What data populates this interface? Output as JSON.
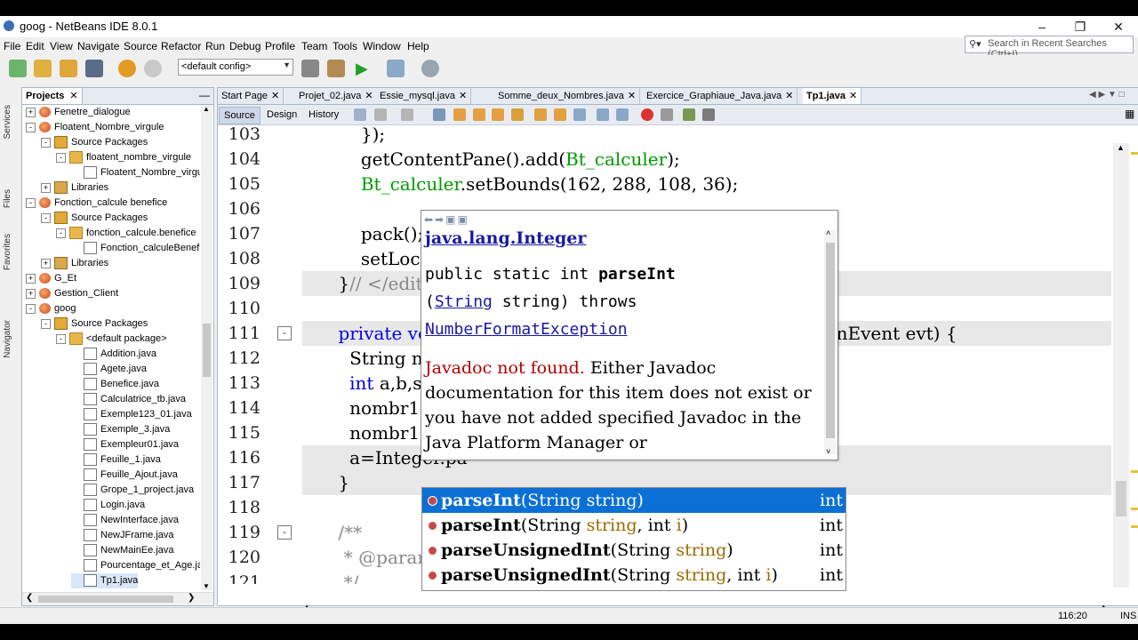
{
  "window": {
    "title": "goog - NetBeans IDE 8.0.1"
  },
  "menu": [
    "File",
    "Edit",
    "View",
    "Navigate",
    "Source",
    "Refactor",
    "Run",
    "Debug",
    "Profile",
    "Team",
    "Tools",
    "Window",
    "Help"
  ],
  "search": {
    "placeholder": "Search in Recent Searches (Ctrl+I)"
  },
  "toolbar": {
    "config_value": "<default config>"
  },
  "side_labels": [
    "Services",
    "Files",
    "Favorites",
    "Navigator"
  ],
  "projects": {
    "tab_label": "Projects",
    "tree": [
      {
        "label": "Fenetre_dialogue",
        "level": 0,
        "icon": "project",
        "exp": "+"
      },
      {
        "label": "Floatent_Nombre_virgule",
        "level": 0,
        "icon": "project",
        "exp": "-"
      },
      {
        "label": "Source Packages",
        "level": 1,
        "icon": "srcpkg",
        "exp": "-"
      },
      {
        "label": "floatent_nombre_virgule",
        "level": 2,
        "icon": "package",
        "exp": "-"
      },
      {
        "label": "Floatent_Nombre_virgule.java",
        "level": 3,
        "icon": "java",
        "exp": ""
      },
      {
        "label": "Libraries",
        "level": 1,
        "icon": "library",
        "exp": "+"
      },
      {
        "label": "Fonction_calcule benefice",
        "level": 0,
        "icon": "project",
        "exp": "-"
      },
      {
        "label": "Source Packages",
        "level": 1,
        "icon": "srcpkg",
        "exp": "-"
      },
      {
        "label": "fonction_calcule.benefice",
        "level": 2,
        "icon": "package",
        "exp": "-"
      },
      {
        "label": "Fonction_calculeBenefice.java",
        "level": 3,
        "icon": "java",
        "exp": ""
      },
      {
        "label": "Libraries",
        "level": 1,
        "icon": "library",
        "exp": "+"
      },
      {
        "label": "G_Et",
        "level": 0,
        "icon": "project",
        "exp": "+"
      },
      {
        "label": "Gestion_Client",
        "level": 0,
        "icon": "project",
        "exp": "+"
      },
      {
        "label": "goog",
        "level": 0,
        "icon": "project",
        "exp": "-"
      },
      {
        "label": "Source Packages",
        "level": 1,
        "icon": "srcpkg",
        "exp": "-"
      },
      {
        "label": "<default package>",
        "level": 2,
        "icon": "package",
        "exp": "-"
      },
      {
        "label": "Addition.java",
        "level": 3,
        "icon": "java",
        "exp": ""
      },
      {
        "label": "Agete.java",
        "level": 3,
        "icon": "java",
        "exp": ""
      },
      {
        "label": "Benefice.java",
        "level": 3,
        "icon": "java",
        "exp": ""
      },
      {
        "label": "Calculatrice_tb.java",
        "level": 3,
        "icon": "java",
        "exp": ""
      },
      {
        "label": "Exemple123_01.java",
        "level": 3,
        "icon": "java",
        "exp": ""
      },
      {
        "label": "Exemple_3.java",
        "level": 3,
        "icon": "java",
        "exp": ""
      },
      {
        "label": "Exempleur01.java",
        "level": 3,
        "icon": "java",
        "exp": ""
      },
      {
        "label": "Feuille_1.java",
        "level": 3,
        "icon": "java",
        "exp": ""
      },
      {
        "label": "Feuille_Ajout.java",
        "level": 3,
        "icon": "java",
        "exp": ""
      },
      {
        "label": "Grope_1_project.java",
        "level": 3,
        "icon": "java",
        "exp": ""
      },
      {
        "label": "Login.java",
        "level": 3,
        "icon": "java",
        "exp": ""
      },
      {
        "label": "NewInterface.java",
        "level": 3,
        "icon": "java",
        "exp": ""
      },
      {
        "label": "NewJFrame.java",
        "level": 3,
        "icon": "java",
        "exp": ""
      },
      {
        "label": "NewMainEe.java",
        "level": 3,
        "icon": "java",
        "exp": ""
      },
      {
        "label": "Pourcentage_et_Age.java",
        "level": 3,
        "icon": "java",
        "exp": ""
      },
      {
        "label": "Tp1.java",
        "level": 3,
        "icon": "java",
        "exp": "",
        "selected": true
      }
    ]
  },
  "editor": {
    "tabs": [
      {
        "label": "Start Page"
      },
      {
        "label": "Projet_02.java"
      },
      {
        "label": "Essie_mysql.java"
      },
      {
        "label": "Somme_deux_Nombres.java"
      },
      {
        "label": "Exercice_Graphiaue_Java.java"
      },
      {
        "label": "Tp1.java",
        "active": true
      }
    ],
    "subtabs": [
      "Source",
      "Design",
      "History"
    ],
    "lines": [
      {
        "n": "103",
        "segs": [
          {
            "t": "        });"
          }
        ]
      },
      {
        "n": "104",
        "segs": [
          {
            "t": "        getContentPane().add("
          },
          {
            "t": "Bt_calculer",
            "c": "fld"
          },
          {
            "t": ");"
          }
        ]
      },
      {
        "n": "105",
        "segs": [
          {
            "t": "        "
          },
          {
            "t": "Bt_calculer",
            "c": "fld"
          },
          {
            "t": ".setBounds(162, 288, 108, 36);"
          }
        ]
      },
      {
        "n": "106",
        "segs": [
          {
            "t": ""
          }
        ]
      },
      {
        "n": "107",
        "segs": [
          {
            "t": "        pack();"
          }
        ]
      },
      {
        "n": "108",
        "segs": [
          {
            "t": "        setLocat"
          }
        ]
      },
      {
        "n": "109",
        "segs": [
          {
            "t": "    }"
          },
          {
            "t": "// </editor",
            "c": "cmt"
          }
        ],
        "hl": true
      },
      {
        "n": "110",
        "segs": [
          {
            "t": ""
          }
        ]
      },
      {
        "n": "111",
        "segs": [
          {
            "t": "    "
          },
          {
            "t": "private",
            "c": "kw"
          },
          {
            "t": " "
          },
          {
            "t": "voi",
            "c": "kw"
          },
          {
            "t": "                              "
          },
          {
            "t": "                         "
          },
          {
            "t": "vent.ActionEvent evt) {"
          }
        ],
        "fold": "-",
        "hl": true
      },
      {
        "n": "112",
        "segs": [
          {
            "t": "      String n"
          }
        ]
      },
      {
        "n": "113",
        "segs": [
          {
            "t": "      "
          },
          {
            "t": "int",
            "c": "kw"
          },
          {
            "t": " a,b,s"
          }
        ]
      },
      {
        "n": "114",
        "segs": [
          {
            "t": "      nombr1="
          }
        ]
      },
      {
        "n": "115",
        "segs": [
          {
            "t": "      nombr1="
          }
        ]
      },
      {
        "n": "116",
        "segs": [
          {
            "t": "      a=Integer.pa"
          }
        ],
        "hl": true
      },
      {
        "n": "117",
        "segs": [
          {
            "t": "    }"
          }
        ],
        "hl": true
      },
      {
        "n": "118",
        "segs": [
          {
            "t": ""
          }
        ]
      },
      {
        "n": "119",
        "segs": [
          {
            "t": "    /**",
            "c": "cmt"
          }
        ],
        "fold": "-"
      },
      {
        "n": "120",
        "segs": [
          {
            "t": "     * @param",
            "c": "cmt"
          }
        ]
      },
      {
        "n": "121",
        "segs": [
          {
            "t": "     */",
            "c": "cmt"
          }
        ]
      }
    ]
  },
  "javadoc": {
    "title": "java.lang.Integer",
    "sig1": "public static int ",
    "method": "parseInt",
    "sig2_open": "(",
    "sig2_type": "String",
    "sig2_rest": " string) throws",
    "exception": "NumberFormatException",
    "msg_red": "Javadoc not found.",
    "msg_rest": " Either Javadoc documentation for this item does not exist or you have not added specified Javadoc in the Java Platform Manager or"
  },
  "completion": [
    {
      "name": "parseInt",
      "params": [
        {
          "type": "String",
          "name": "string"
        }
      ],
      "ret": "int",
      "selected": true
    },
    {
      "name": "parseInt",
      "params": [
        {
          "type": "String",
          "name": "string"
        },
        {
          "type": "int",
          "name": "i"
        }
      ],
      "ret": "int"
    },
    {
      "name": "parseUnsignedInt",
      "params": [
        {
          "type": "String",
          "name": "string"
        }
      ],
      "ret": "int"
    },
    {
      "name": "parseUnsignedInt",
      "params": [
        {
          "type": "String",
          "name": "string"
        },
        {
          "type": "int",
          "name": "i"
        }
      ],
      "ret": "int"
    }
  ],
  "status": {
    "position": "116:20",
    "mode": "INS"
  }
}
